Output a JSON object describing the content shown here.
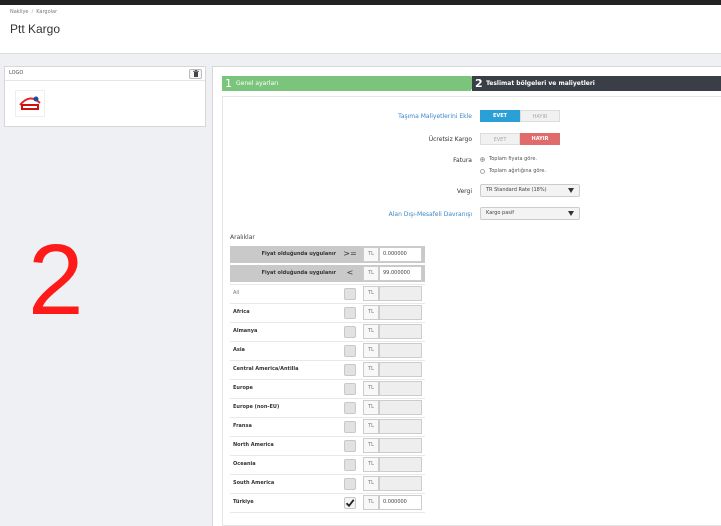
{
  "breadcrumb": {
    "items": [
      "Nakliye",
      "Kargolar"
    ]
  },
  "page": {
    "title": "Ptt Kargo"
  },
  "logo_panel": {
    "label": "LOGO",
    "delete_icon": "trash-icon"
  },
  "overlay_number": "2",
  "steps": [
    {
      "num": "1",
      "label": "Genel ayarları"
    },
    {
      "num": "2",
      "label": "Teslimat bölgeleri ve maliyetleri"
    }
  ],
  "form": {
    "handling": {
      "label": "Taşıma Maliyetlerini Ekle",
      "yes": "EVET",
      "no": "HAYIR",
      "selected": "yes"
    },
    "free_shipping": {
      "label": "Ücretsiz Kargo",
      "yes": "EVET",
      "no": "HAYIR",
      "selected": "no"
    },
    "billing": {
      "label": "Fatura",
      "options": [
        "Toplam fiyata göre.",
        "Toplam ağırlığına göre."
      ],
      "selected": 0
    },
    "tax": {
      "label": "Vergi",
      "value": "TR Standard Rate (18%)"
    },
    "out_of_range": {
      "label": "Alan Dışı-Mesafeli Davranışı",
      "value": "Kargo pasif"
    }
  },
  "ranges": {
    "title": "Aralıklar",
    "conditions": [
      {
        "text": "Fiyat olduğunda uygulanır",
        "op": ">=",
        "currency": "TL",
        "value": "0.000000"
      },
      {
        "text": "Fiyat olduğunda uygulanır",
        "op": "<",
        "currency": "TL",
        "value": "99.000000"
      }
    ],
    "regions": [
      {
        "name": "All",
        "currency": "TL",
        "value": "",
        "checked": false,
        "plain": true
      },
      {
        "name": "Africa",
        "currency": "TL",
        "value": "",
        "checked": false
      },
      {
        "name": "Almanya",
        "currency": "TL",
        "value": "",
        "checked": false
      },
      {
        "name": "Asia",
        "currency": "TL",
        "value": "",
        "checked": false
      },
      {
        "name": "Central America/Antilla",
        "currency": "TL",
        "value": "",
        "checked": false
      },
      {
        "name": "Europe",
        "currency": "TL",
        "value": "",
        "checked": false
      },
      {
        "name": "Europe (non-EU)",
        "currency": "TL",
        "value": "",
        "checked": false
      },
      {
        "name": "Fransa",
        "currency": "TL",
        "value": "",
        "checked": false
      },
      {
        "name": "North America",
        "currency": "TL",
        "value": "",
        "checked": false
      },
      {
        "name": "Oceania",
        "currency": "TL",
        "value": "",
        "checked": false
      },
      {
        "name": "South America",
        "currency": "TL",
        "value": "",
        "checked": false
      },
      {
        "name": "Türkiye",
        "currency": "TL",
        "value": "0.000000",
        "checked": true
      }
    ]
  }
}
